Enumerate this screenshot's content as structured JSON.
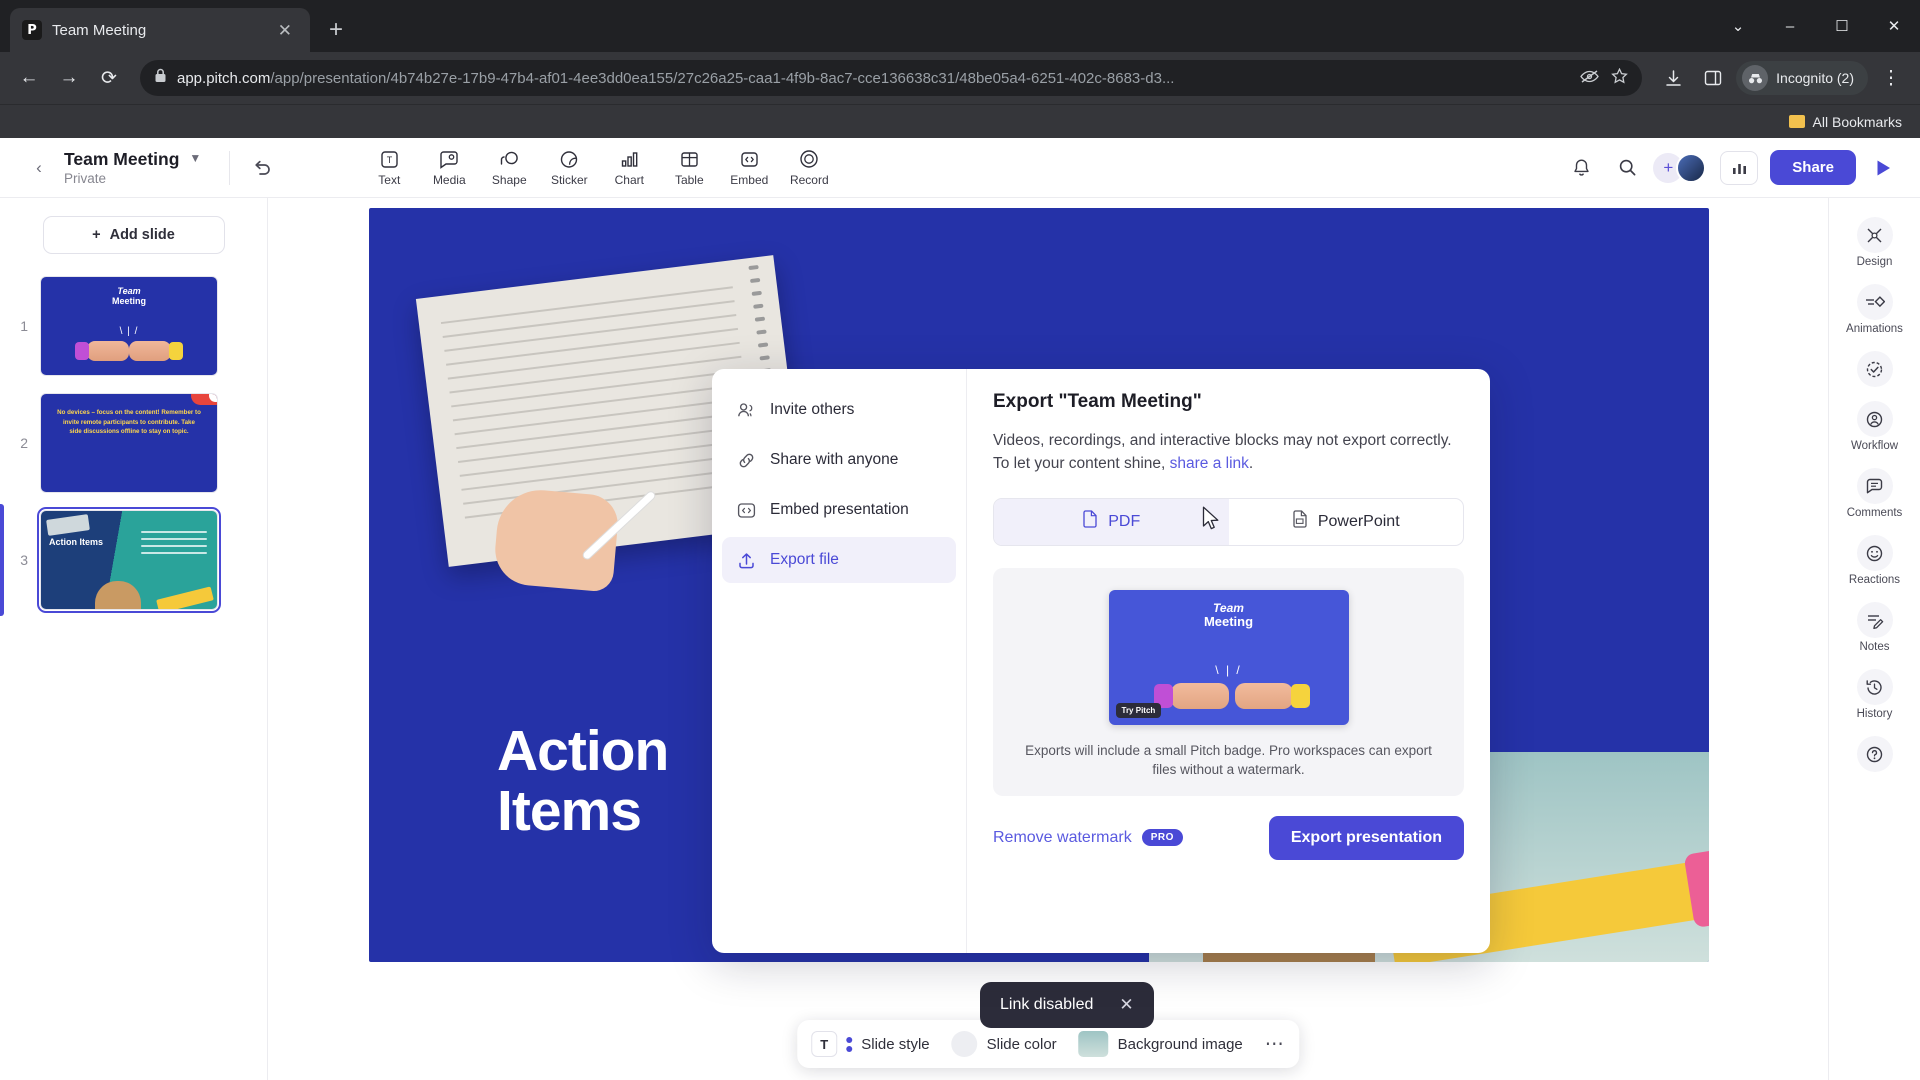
{
  "browser": {
    "tab": {
      "title": "Team Meeting",
      "favicon": "pitch-logo-icon",
      "close_icon": "close-icon"
    },
    "new_tab_icon": "plus-icon",
    "window_controls": {
      "minimize": "–",
      "maximize": "□",
      "close": "✕",
      "chevron": "⌄"
    },
    "nav": {
      "back": "←",
      "forward": "→",
      "reload": "↻",
      "lock_icon": "lock-icon"
    },
    "url": {
      "domain": "app.pitch.com",
      "path": "/app/presentation/4b74b27e-17b9-47b4-af01-4ee3dd0ea155/27c26a25-caa1-4f9b-8ac7-cce136638c31/48be05a4-6251-402c-8683-d3..."
    },
    "url_actions": {
      "no_track": "eye-off-icon",
      "bookmark": "star-icon",
      "download": "download-icon",
      "side_panel": "side-panel-icon",
      "menu": "kebab-menu-icon"
    },
    "profile": {
      "label": "Incognito (2)",
      "icon": "incognito-icon"
    },
    "bookmarks": {
      "folder_label": "All Bookmarks"
    }
  },
  "app_header": {
    "back_icon": "chevron-left-icon",
    "title": "Team Meeting",
    "caret_icon": "chevron-down-icon",
    "subtitle": "Private",
    "undo_icon": "undo-icon",
    "tools": [
      {
        "label": "Text",
        "icon": "text-box-icon"
      },
      {
        "label": "Media",
        "icon": "image-icon"
      },
      {
        "label": "Shape",
        "icon": "shape-icon"
      },
      {
        "label": "Sticker",
        "icon": "sticker-icon"
      },
      {
        "label": "Chart",
        "icon": "bar-chart-icon"
      },
      {
        "label": "Table",
        "icon": "table-icon"
      },
      {
        "label": "Embed",
        "icon": "code-embed-icon"
      },
      {
        "label": "Record",
        "icon": "record-circle-icon"
      }
    ],
    "right": {
      "bell_icon": "notification-bell-icon",
      "search_icon": "search-icon",
      "add_member_icon": "plus-icon",
      "avatar_initial": "●",
      "analytics_icon": "analytics-bars-icon",
      "share_label": "Share",
      "present_icon": "play-icon"
    }
  },
  "slides_panel": {
    "add_slide_label": "Add slide",
    "add_icon": "plus-icon",
    "slides": [
      {
        "number": "1",
        "title_line1": "Team",
        "title_line2": "Meeting",
        "active": false
      },
      {
        "number": "2",
        "body": "No devices – focus on the content! Remember to invite remote participants to contribute. Take side discussions offline to stay on topic.",
        "active": false,
        "badge": "toggle-badge"
      },
      {
        "number": "3",
        "title": "Action Items",
        "active": true
      }
    ]
  },
  "canvas": {
    "slide_title_line1": "Action",
    "slide_title_line2": "Items"
  },
  "share_popover": {
    "menu": [
      {
        "label": "Invite others",
        "icon": "people-icon",
        "active": false
      },
      {
        "label": "Share with anyone",
        "icon": "link-icon",
        "active": false
      },
      {
        "label": "Embed presentation",
        "icon": "code-embed-icon",
        "active": false
      },
      {
        "label": "Export file",
        "icon": "upload-icon",
        "active": true
      }
    ],
    "export": {
      "heading": "Export \"Team Meeting\"",
      "description_part1": "Videos, recordings, and interactive blocks may not export correctly. To let your content shine, ",
      "description_link": "share a link",
      "description_part2": ".",
      "formats": [
        {
          "label": "PDF",
          "icon": "pdf-file-icon",
          "selected": true
        },
        {
          "label": "PowerPoint",
          "icon": "ppt-file-icon",
          "selected": false
        }
      ],
      "preview": {
        "title_line1": "Team",
        "title_line2": "Meeting",
        "badge": "Try Pitch"
      },
      "note": "Exports will include a small Pitch badge. Pro workspaces can export files without a watermark.",
      "remove_watermark_label": "Remove watermark",
      "pro_badge": "PRO",
      "export_button_label": "Export presentation"
    }
  },
  "right_rail": [
    {
      "label": "Design",
      "icon": "design-scissors-icon"
    },
    {
      "label": "Animations",
      "icon": "animations-icon"
    },
    {
      "label": "Workflow",
      "icon": "workflow-check-icon",
      "icon2": "workflow-person-icon"
    },
    {
      "label": "Comments",
      "icon": "comment-bubble-icon"
    },
    {
      "label": "Reactions",
      "icon": "smiley-icon"
    },
    {
      "label": "Notes",
      "icon": "notes-pencil-icon"
    },
    {
      "label": "History",
      "icon": "history-clock-icon"
    },
    {
      "label": "",
      "icon": "help-question-icon"
    }
  ],
  "bottom_bar": {
    "slide_style_label": "Slide style",
    "slide_style_icon": "text-style-icon",
    "slide_color_label": "Slide color",
    "slide_color_icon": "color-circle-icon",
    "background_image_label": "Background image",
    "background_image_icon": "image-thumb-icon",
    "more_icon": "ellipsis-icon"
  },
  "toast": {
    "message": "Link disabled",
    "close_icon": "close-icon"
  },
  "colors": {
    "accent": "#4a49d6",
    "slide_blue": "#2532a8",
    "preview_blue": "#4656d8",
    "toast_bg": "#2c2c3a",
    "badge_red": "#e8453c"
  }
}
